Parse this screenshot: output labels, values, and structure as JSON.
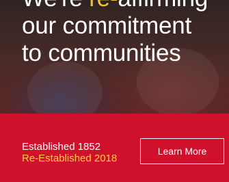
{
  "headline": {
    "line1_prefix": "We're ",
    "line1_accent": "re-",
    "line1_suffix": "affirming",
    "line2": "our commitment",
    "line3": "to communities"
  },
  "tagline": {
    "established": "Established 1852",
    "reestablished": "Re-Established 2018"
  },
  "cta": {
    "label": "Learn More"
  },
  "colors": {
    "band_red": "#d0112b",
    "accent_yellow": "#f5c431",
    "text_white": "#ffffff"
  }
}
